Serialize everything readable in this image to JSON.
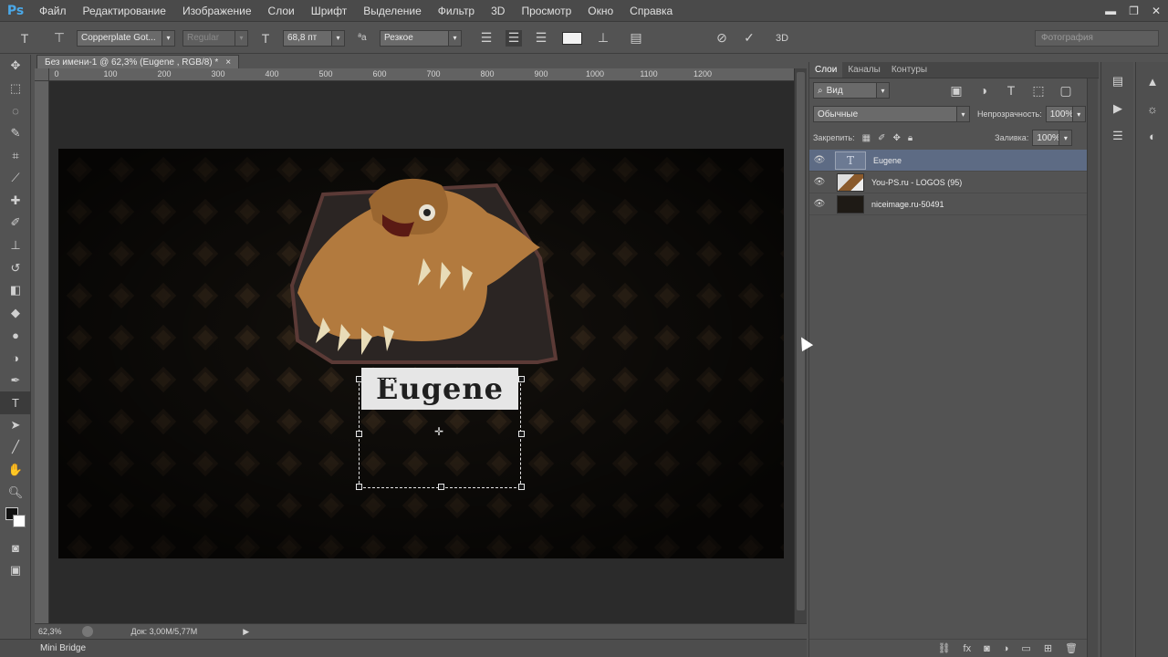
{
  "app": {
    "logo": "Ps"
  },
  "menu": [
    "Файл",
    "Редактирование",
    "Изображение",
    "Слои",
    "Шрифт",
    "Выделение",
    "Фильтр",
    "3D",
    "Просмотр",
    "Окно",
    "Справка"
  ],
  "window_controls": {
    "minimize": "▬",
    "restore": "❐",
    "close": "✕"
  },
  "options": {
    "font_family": "Copperplate Got...",
    "font_style": "Regular",
    "font_size": "68,8 пт",
    "aa_label": "ªa",
    "antialias": "Резкое",
    "workspace": "Фотография",
    "commit_3d": "3D"
  },
  "document": {
    "tab_title": "Без имени-1 @ 62,3% (Eugene , RGB/8) *",
    "close": "×",
    "zoom": "62,3%",
    "doc_size": "Док: 3,00М/5,77М",
    "mini_bridge": "Mini Bridge",
    "canvas_text": "Eugene"
  },
  "ruler_ticks": [
    "0",
    "100",
    "200",
    "300",
    "400",
    "500",
    "600",
    "700",
    "800",
    "900",
    "1000",
    "1100",
    "1200"
  ],
  "layers_panel": {
    "tabs": [
      "Слои",
      "Каналы",
      "Контуры"
    ],
    "filter_kind": "Вид",
    "blend_mode": "Обычные",
    "opacity_label": "Непрозрачность:",
    "opacity_value": "100%",
    "lock_label": "Закрепить:",
    "fill_label": "Заливка:",
    "fill_value": "100%",
    "layers": [
      {
        "name": "Eugene",
        "type": "text",
        "selected": true
      },
      {
        "name": "You-PS.ru - LOGOS (95)",
        "type": "image",
        "selected": false
      },
      {
        "name": "niceimage.ru-50491",
        "type": "image",
        "selected": false
      }
    ]
  },
  "colors": {
    "accent_blue": "#4aa8e8",
    "selected_layer": "#5d6b84",
    "panel_bg": "#535353",
    "canvas_bg": "#1c1712"
  }
}
